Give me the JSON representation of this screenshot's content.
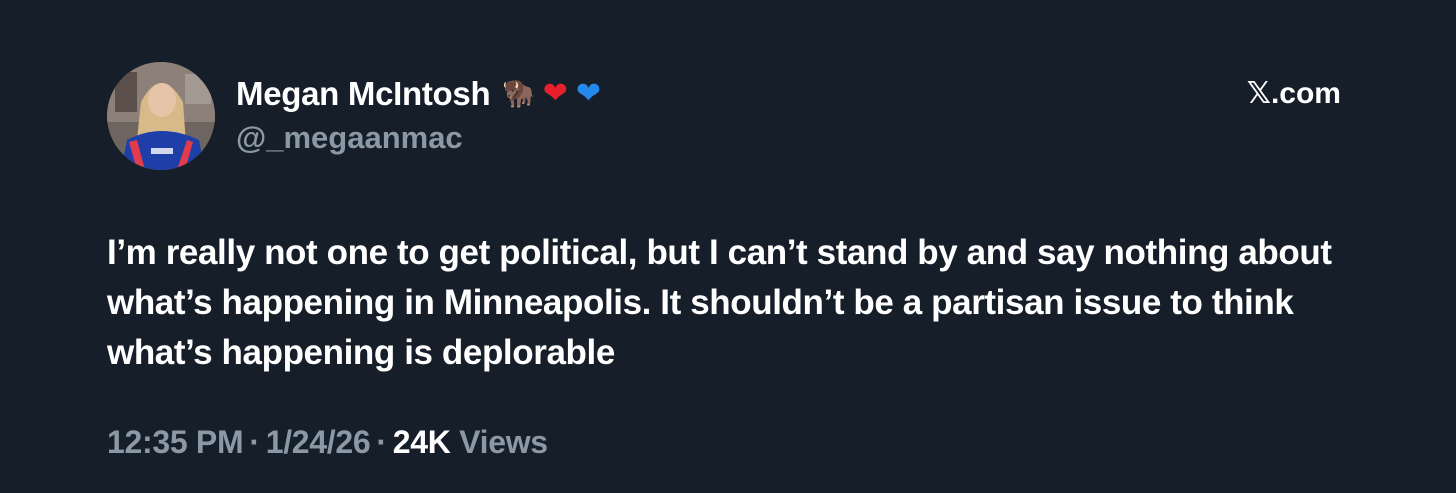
{
  "author": {
    "display_name": "Megan McIntosh",
    "badges": [
      "bison-emoji",
      "red-heart-emoji",
      "blue-heart-emoji"
    ],
    "handle": "@_megaanmac"
  },
  "source": "𝕏.com",
  "tweet": {
    "text": "I’m really not one to get political, but I can’t stand by and say nothing about what’s happening in Minneapolis. It shouldn’t be a partisan issue to think what’s happening is deplorable"
  },
  "meta": {
    "time": "12:35 PM",
    "separator": "·",
    "date": "1/24/26",
    "views_count": "24K",
    "views_label": "Views"
  },
  "colors": {
    "background": "#161e29",
    "primary_text": "#ffffff",
    "secondary_text": "#8b98a5",
    "red_heart": "#e8202b",
    "blue_heart": "#2489ee"
  }
}
